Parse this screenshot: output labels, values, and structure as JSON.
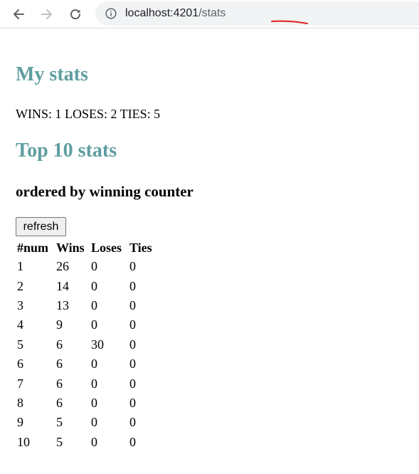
{
  "browser": {
    "url_host": "localhost:4201",
    "url_path": "/stats"
  },
  "my_stats": {
    "title": "My stats",
    "summary": "WINS: 1 LOSES: 2 TIES: 5"
  },
  "top_stats": {
    "title": "Top 10 stats",
    "subtitle": "ordered by winning counter",
    "refresh_label": "refresh",
    "columns": [
      "#num",
      "Wins",
      "Loses",
      "Ties"
    ],
    "rows": [
      [
        "1",
        "26",
        "0",
        "0"
      ],
      [
        "2",
        "14",
        "0",
        "0"
      ],
      [
        "3",
        "13",
        "0",
        "0"
      ],
      [
        "4",
        "9",
        "0",
        "0"
      ],
      [
        "5",
        "6",
        "30",
        "0"
      ],
      [
        "6",
        "6",
        "0",
        "0"
      ],
      [
        "7",
        "6",
        "0",
        "0"
      ],
      [
        "8",
        "6",
        "0",
        "0"
      ],
      [
        "9",
        "5",
        "0",
        "0"
      ],
      [
        "10",
        "5",
        "0",
        "0"
      ]
    ]
  },
  "colors": {
    "heading": "#5f9ea0",
    "annotation": "#e0201c"
  },
  "icons": [
    "back-arrow-icon",
    "forward-arrow-icon",
    "reload-icon",
    "info-icon"
  ]
}
